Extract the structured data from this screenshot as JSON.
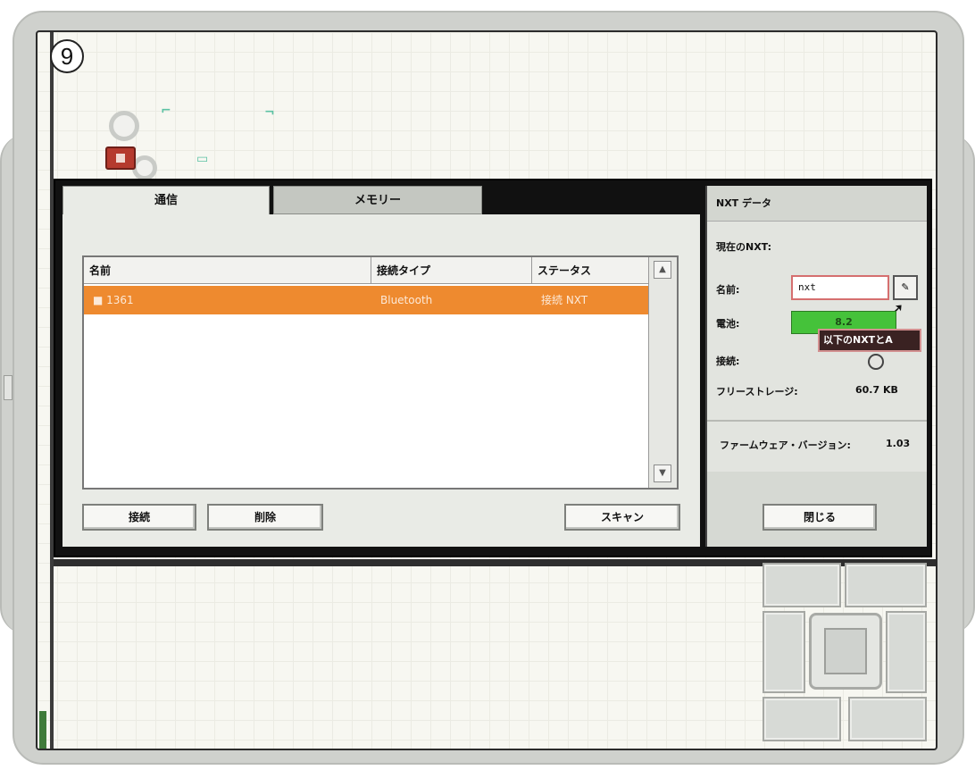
{
  "step_number": "9",
  "tabs": {
    "active": "通信",
    "inactive": "メモリー"
  },
  "list": {
    "columns": [
      "名前",
      "接続タイプ",
      "ステータス"
    ],
    "selected_row": {
      "name": "■ 1361",
      "type": "Bluetooth",
      "status": "接続 NXT"
    },
    "scroll_up": "▲",
    "scroll_down": "▼"
  },
  "buttons": {
    "connect": "接続",
    "remove": "削除",
    "scan": "スキャン",
    "close": "閉じる"
  },
  "nxt_panel": {
    "title": "NXT データ",
    "header": "現在のNXT:",
    "name_label": "名前:",
    "name_value": "nxt",
    "rename_button": "✎",
    "battery_label": "電池:",
    "battery_value": "8.2",
    "tooltip": "以下のNXTとA",
    "connection_label": "接続:",
    "storage_label": "フリーストレージ:",
    "storage_value": "60.7 KB",
    "firmware_label": "ファームウェア・バージョン:",
    "firmware_value": "1.03"
  },
  "icons": {
    "cursor": "cursor-arrow-icon",
    "connection": "connection-icon",
    "gear": "gear-icon"
  }
}
